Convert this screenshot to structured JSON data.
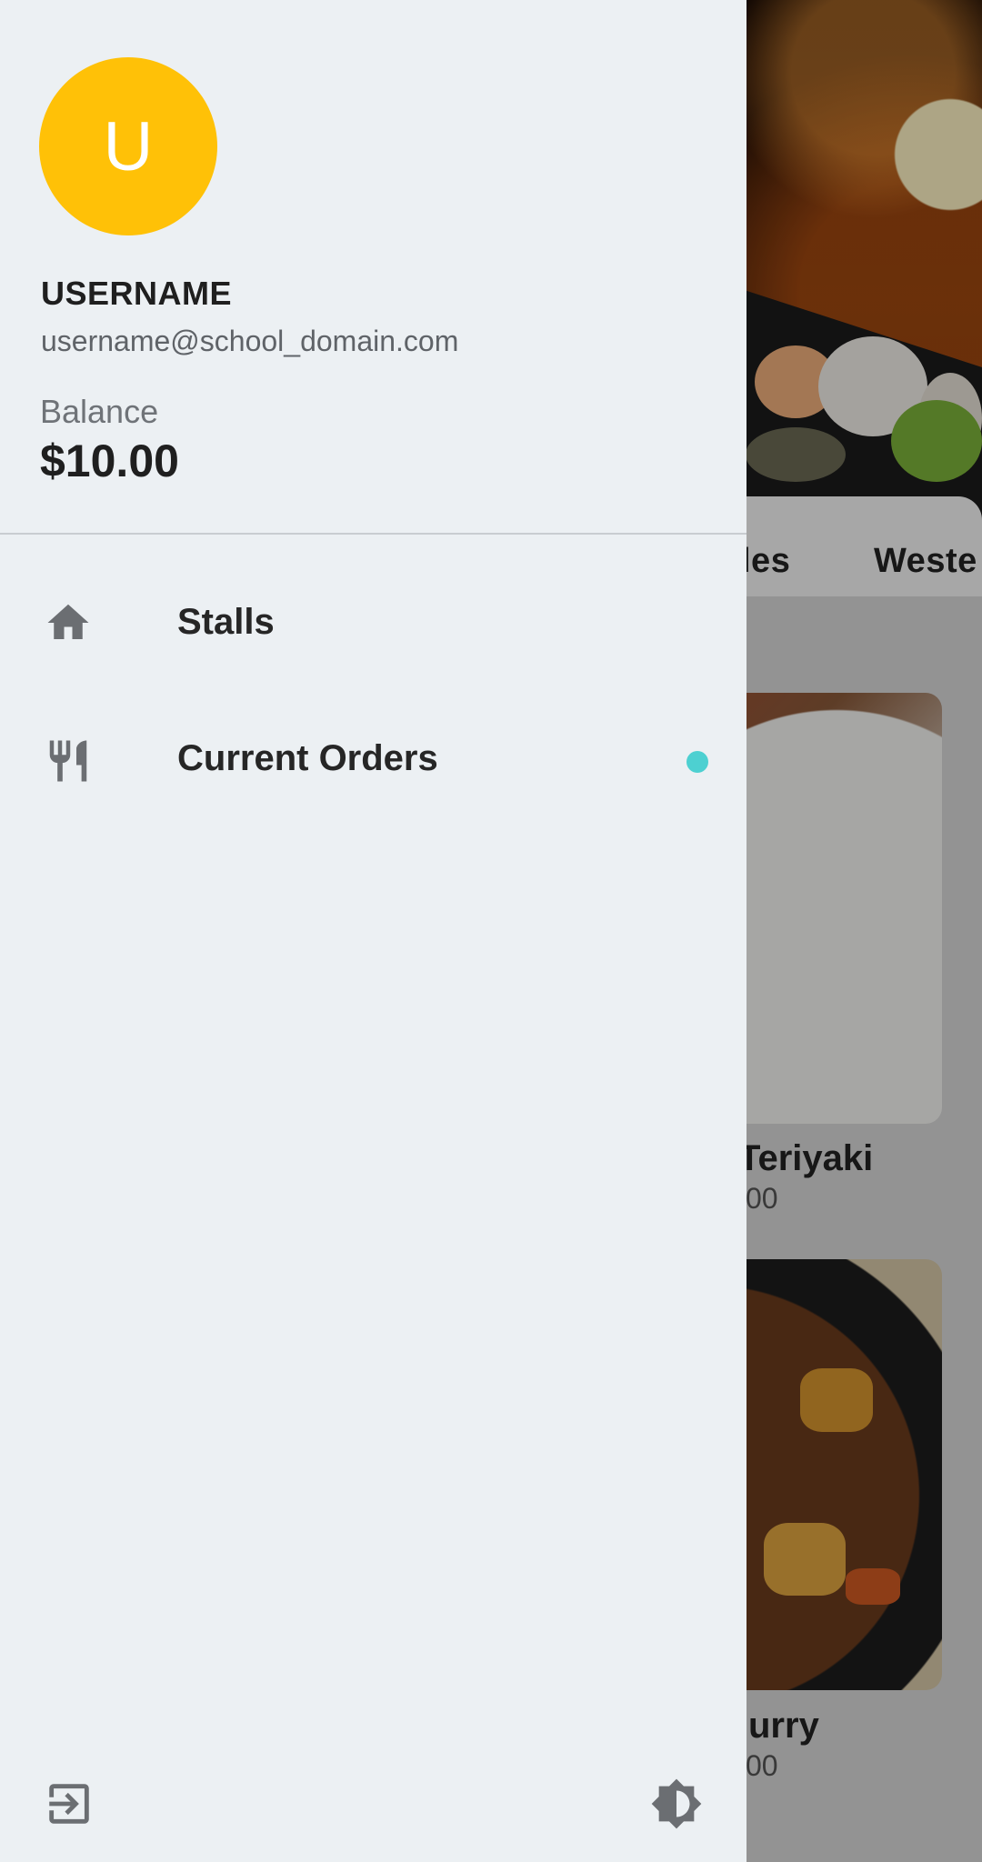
{
  "drawer": {
    "avatar_initial": "U",
    "avatar_color": "#ffc107",
    "username": "USERNAME",
    "email": "username@school_domain.com",
    "balance_label": "Balance",
    "balance_value": "$10.00",
    "nav_items": [
      {
        "label": "Stalls",
        "icon": "home-icon",
        "has_badge": false
      },
      {
        "label": "Current Orders",
        "icon": "restaurant-icon",
        "has_badge": true
      }
    ],
    "badge_color": "#4dd0d1",
    "bottom_icons": {
      "left": "logout-icon",
      "right": "brightness-icon"
    }
  },
  "background": {
    "categories_visible": [
      "les",
      "Weste"
    ],
    "dishes": [
      {
        "name": "Teriyaki",
        "price": "00"
      },
      {
        "name": "urry",
        "price": "00"
      }
    ]
  }
}
